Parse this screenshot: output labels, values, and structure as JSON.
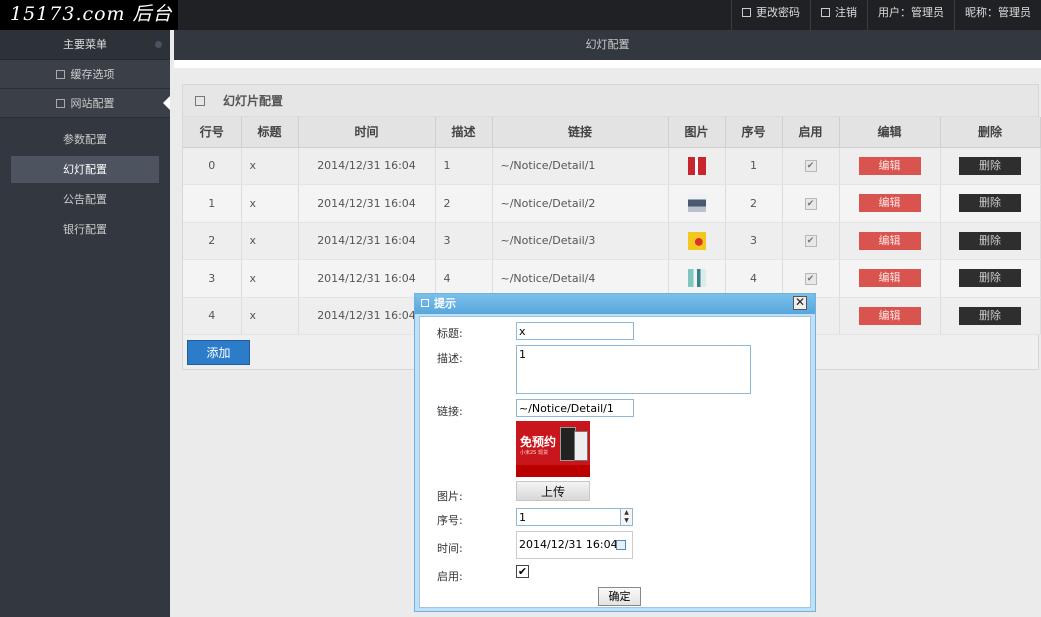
{
  "header": {
    "logo": "15173.com 后台",
    "links": [
      {
        "label": "更改密码",
        "icon": "box-icon"
      },
      {
        "label": "注销",
        "icon": "box-icon"
      },
      {
        "label": "用户：管理员"
      },
      {
        "label": "昵称：管理员"
      }
    ]
  },
  "sidebar": {
    "title": "主要菜单",
    "sections": [
      {
        "label": "缓存选项"
      },
      {
        "label": "网站配置"
      }
    ],
    "items": [
      {
        "label": "参数配置"
      },
      {
        "label": "幻灯配置"
      },
      {
        "label": "公告配置"
      },
      {
        "label": "银行配置"
      }
    ]
  },
  "main": {
    "header": "幻灯配置",
    "panel_title": "幻灯片配置",
    "columns": [
      "行号",
      "标题",
      "时间",
      "描述",
      "链接",
      "图片",
      "序号",
      "启用",
      "编辑",
      "删除"
    ],
    "rows": [
      {
        "row": "0",
        "title": "x",
        "time": "2014/12/31 16:04",
        "desc": "1",
        "link": "~/Notice/Detail/1",
        "order": "1",
        "edit": "编辑",
        "del": "删除"
      },
      {
        "row": "1",
        "title": "x",
        "time": "2014/12/31 16:04",
        "desc": "2",
        "link": "~/Notice/Detail/2",
        "order": "2",
        "edit": "编辑",
        "del": "删除"
      },
      {
        "row": "2",
        "title": "x",
        "time": "2014/12/31 16:04",
        "desc": "3",
        "link": "~/Notice/Detail/3",
        "order": "3",
        "edit": "编辑",
        "del": "删除"
      },
      {
        "row": "3",
        "title": "x",
        "time": "2014/12/31 16:04",
        "desc": "4",
        "link": "~/Notice/Detail/4",
        "order": "4",
        "edit": "编辑",
        "del": "删除"
      },
      {
        "row": "4",
        "title": "x",
        "time": "2014/12/31 16:04",
        "desc": "",
        "link": "",
        "order": "",
        "edit": "编辑",
        "del": "删除"
      }
    ],
    "add_label": "添加"
  },
  "dialog": {
    "title": "提示",
    "close": "✕",
    "labels": {
      "title": "标题:",
      "desc": "描述:",
      "link": "链接:",
      "image": "图片:",
      "order": "序号:",
      "time": "时间:",
      "enabled": "启用:"
    },
    "values": {
      "title": "x",
      "desc": "1",
      "link": "~/Notice/Detail/1",
      "order": "1",
      "time": "2014/12/31 16:04",
      "enabled": "✔"
    },
    "preview": {
      "headline": "免预约",
      "sub": "小米2S 现货",
      "upload_label": "上传"
    },
    "ok_label": "确定"
  },
  "colors": {
    "edit_button": "#d9534f",
    "delete_button": "#2e2e2e",
    "add_button": "#2d7cc9",
    "dialog_border": "#6fb2e0"
  }
}
